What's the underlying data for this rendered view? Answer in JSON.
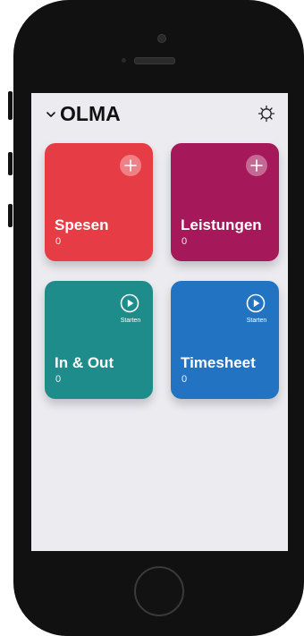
{
  "app": {
    "title": "OLMA"
  },
  "icons": {
    "header_chevron": "chevron-down-icon",
    "header_settings": "gear-icon",
    "add": "plus-circle-icon",
    "start": "play-circle-icon"
  },
  "tiles": [
    {
      "label": "Spesen",
      "count": "0",
      "action": "add",
      "color": "#e63c46"
    },
    {
      "label": "Leistungen",
      "count": "0",
      "action": "add",
      "color": "#a5195a"
    },
    {
      "label": "In & Out",
      "count": "0",
      "action": "start",
      "action_label": "Starten",
      "color": "#1f8c8c"
    },
    {
      "label": "Timesheet",
      "count": "0",
      "action": "start",
      "action_label": "Starten",
      "color": "#2373c3"
    }
  ]
}
